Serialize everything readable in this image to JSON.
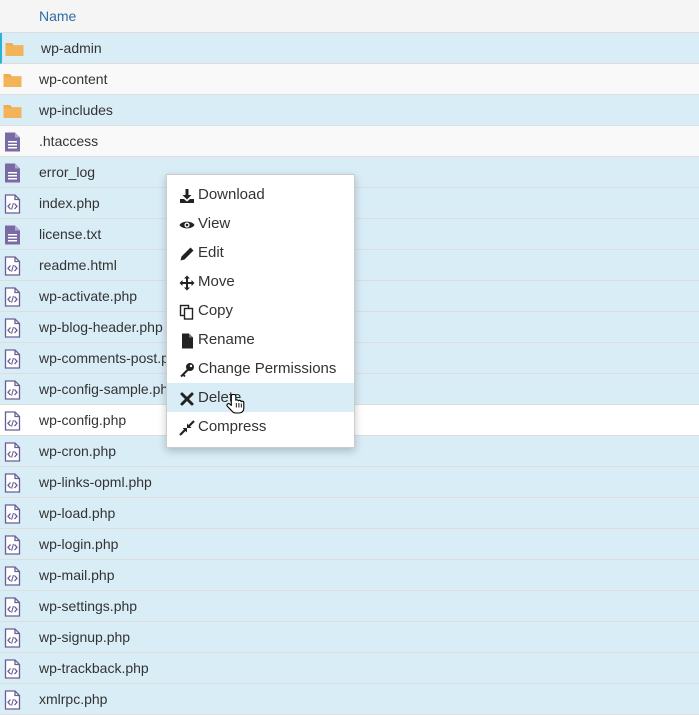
{
  "header": {
    "name_column": "Name"
  },
  "files": [
    {
      "name": "wp-admin",
      "icon": "folder-icon",
      "state": "selected"
    },
    {
      "name": "wp-content",
      "icon": "folder-icon",
      "state": "unselected"
    },
    {
      "name": "wp-includes",
      "icon": "folder-icon",
      "state": "selected"
    },
    {
      "name": ".htaccess",
      "icon": "text-file-icon",
      "state": "unselected"
    },
    {
      "name": "error_log",
      "icon": "text-file-icon",
      "state": "selected"
    },
    {
      "name": "index.php",
      "icon": "code-file-icon",
      "state": "selected"
    },
    {
      "name": "license.txt",
      "icon": "text-file-icon",
      "state": "selected"
    },
    {
      "name": "readme.html",
      "icon": "code-file-icon",
      "state": "selected"
    },
    {
      "name": "wp-activate.php",
      "icon": "code-file-icon",
      "state": "selected"
    },
    {
      "name": "wp-blog-header.php",
      "icon": "code-file-icon",
      "state": "selected"
    },
    {
      "name": "wp-comments-post.php",
      "icon": "code-file-icon",
      "state": "selected"
    },
    {
      "name": "wp-config-sample.php",
      "icon": "code-file-icon",
      "state": "selected"
    },
    {
      "name": "wp-config.php",
      "icon": "code-file-icon",
      "state": "white"
    },
    {
      "name": "wp-cron.php",
      "icon": "code-file-icon",
      "state": "selected"
    },
    {
      "name": "wp-links-opml.php",
      "icon": "code-file-icon",
      "state": "selected"
    },
    {
      "name": "wp-load.php",
      "icon": "code-file-icon",
      "state": "selected"
    },
    {
      "name": "wp-login.php",
      "icon": "code-file-icon",
      "state": "selected"
    },
    {
      "name": "wp-mail.php",
      "icon": "code-file-icon",
      "state": "selected"
    },
    {
      "name": "wp-settings.php",
      "icon": "code-file-icon",
      "state": "selected"
    },
    {
      "name": "wp-signup.php",
      "icon": "code-file-icon",
      "state": "selected"
    },
    {
      "name": "wp-trackback.php",
      "icon": "code-file-icon",
      "state": "selected"
    },
    {
      "name": "xmlrpc.php",
      "icon": "code-file-icon",
      "state": "selected"
    }
  ],
  "context_menu": {
    "items": [
      {
        "label": "Download",
        "icon": "download-icon"
      },
      {
        "label": "View",
        "icon": "eye-icon"
      },
      {
        "label": "Edit",
        "icon": "pencil-icon"
      },
      {
        "label": "Move",
        "icon": "move-arrows-icon"
      },
      {
        "label": "Copy",
        "icon": "copy-icon"
      },
      {
        "label": "Rename",
        "icon": "file-icon"
      },
      {
        "label": "Change Permissions",
        "icon": "key-icon"
      },
      {
        "label": "Delete",
        "icon": "close-icon",
        "active": true
      },
      {
        "label": "Compress",
        "icon": "compress-icon"
      }
    ]
  },
  "colors": {
    "selected_row": "#d9edf7",
    "unselected_row": "#f9f9f9",
    "folder": "#f0ad4e",
    "file_icon": "#7b6ba5",
    "header_link": "#2e6da4"
  }
}
